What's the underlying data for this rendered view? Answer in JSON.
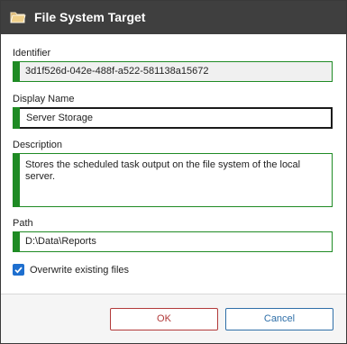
{
  "window": {
    "title": "File System Target",
    "icon": "folder-icon"
  },
  "fields": {
    "identifier": {
      "label": "Identifier",
      "value": "3d1f526d-042e-488f-a522-581138a15672"
    },
    "display_name": {
      "label": "Display Name",
      "value": "Server Storage"
    },
    "description": {
      "label": "Description",
      "value": "Stores the scheduled task output on the file system of the local server."
    },
    "path": {
      "label": "Path",
      "value": "D:\\Data\\Reports"
    }
  },
  "overwrite": {
    "label": "Overwrite existing files",
    "checked": true
  },
  "buttons": {
    "ok": "OK",
    "cancel": "Cancel"
  },
  "colors": {
    "titlebar": "#3f3f3f",
    "field_accent": "#1f8b24",
    "checkbox": "#1e6fcf",
    "ok_button": "#b23a3a",
    "cancel_button": "#2f6fa8"
  }
}
